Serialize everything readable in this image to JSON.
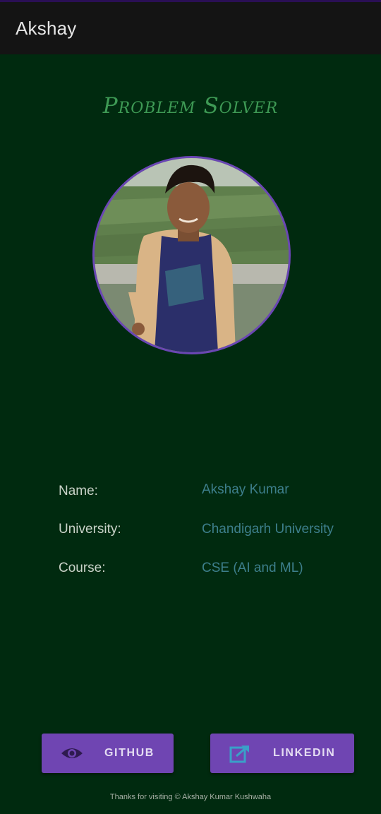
{
  "app_bar": {
    "title": "Akshay"
  },
  "header": {
    "tagline": "Problem Solver"
  },
  "profile": {
    "avatar_description": "profile-photo"
  },
  "info": [
    {
      "label": "Name:",
      "value": "Akshay Kumar"
    },
    {
      "label": "University:",
      "value": "Chandigarh University"
    },
    {
      "label": "Course:",
      "value": "CSE (AI and ML)"
    }
  ],
  "buttons": {
    "github": {
      "label": "GITHUB",
      "icon": "eye-icon"
    },
    "linkedin": {
      "label": "LINKEDIN",
      "icon": "share-icon"
    }
  },
  "footer": {
    "text": "Thanks for visiting © Akshay Kumar Kushwaha"
  },
  "colors": {
    "background": "#002a0f",
    "app_bar": "#141414",
    "tagline": "#3e9a55",
    "button": "#6f45b2",
    "value_text": "#3d7f8c",
    "avatar_border": "#6a46b4"
  }
}
